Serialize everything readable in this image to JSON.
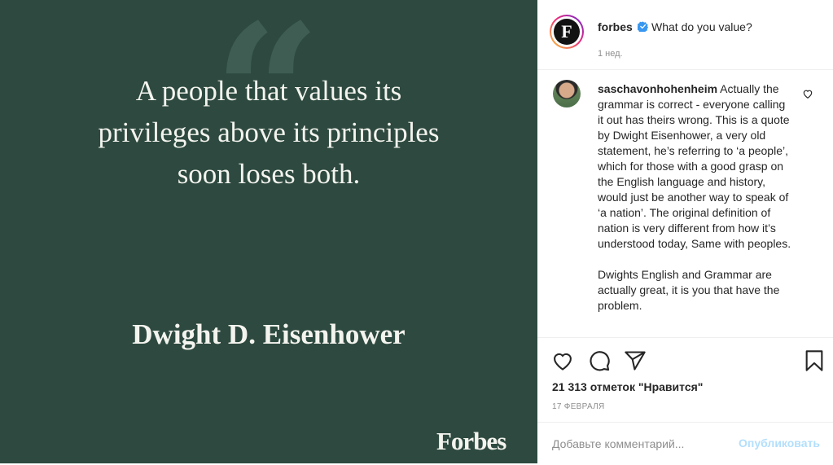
{
  "post_image": {
    "quote_mark": "“",
    "quote_lines": [
      "A people that values its",
      "privileges above its principles",
      "soon loses both."
    ],
    "author": "Dwight D. Eisenhower",
    "brand": "Forbes",
    "background_color": "#2e4a40"
  },
  "header": {
    "avatar_letter": "F",
    "username": "forbes",
    "verified_icon": "verified-badge-icon",
    "caption": "What do you value?",
    "time": "1 нед."
  },
  "comment": {
    "username": "saschavonhohenheim",
    "text_p1": "Actually the grammar is correct - everyone calling it out has theirs wrong. This is a quote by Dwight Eisenhower, a very old statement, he’s referring to ‘a people’, which for those with a good grasp on the English language and history, would just be another way to speak of ‘a nation’. The original definition of nation is very different from how it’s understood today, Same with peoples.",
    "text_p2": "Dwights English and Grammar are actually great, it is you that have the problem."
  },
  "actions": {
    "icons": [
      "heart-icon",
      "comment-icon",
      "share-icon",
      "bookmark-icon"
    ],
    "likes": "21 313 отметок \"Нравится\"",
    "date": "17 ФЕВРАЛЯ"
  },
  "add_comment": {
    "placeholder": "Добавьте комментарий...",
    "post_label": "Опубликовать"
  },
  "colors": {
    "accent_disabled": "#b2dffc",
    "verified": "#3897f0",
    "text": "#262626",
    "muted": "#8e8e8e"
  }
}
